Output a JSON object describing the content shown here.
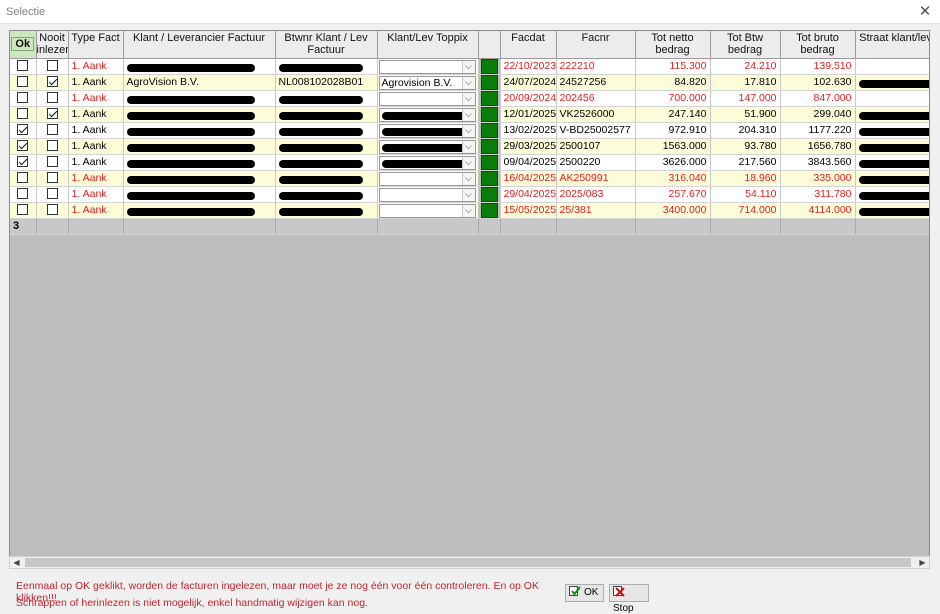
{
  "window": {
    "title": "Selectie",
    "close_glyph": "✕"
  },
  "columns": {
    "ok": "Ok",
    "nooit": "Nooit inlezen",
    "type": "Type Fact",
    "klant": "Klant / Leverancier Factuur",
    "btw": "Btwnr Klant / Lev Factuur",
    "toppix": "Klant/Lev Toppix",
    "status": "",
    "facdat": "Facdat",
    "facnr": "Facnr",
    "netto": "Tot netto bedrag",
    "btwbedrag": "Tot Btw bedrag",
    "bruto": "Tot bruto bedrag",
    "straat": "Straat klant/lev"
  },
  "rows": [
    {
      "ok": false,
      "nooit": false,
      "type": "1. Aank",
      "klant": "",
      "btw": "",
      "toppix": "",
      "facdat": "22/10/2023",
      "facnr": "222210",
      "netto": "115.300",
      "btwbedrag": "24.210",
      "bruto": "139.510",
      "red": true,
      "redact_klant": true,
      "redact_btw": true,
      "redact_toppix": false,
      "redact_straat": false
    },
    {
      "ok": false,
      "nooit": true,
      "type": "1. Aank",
      "klant": "AgroVision B.V.",
      "btw": "NL008102028B01",
      "toppix": "Agrovision B.V.",
      "facdat": "24/07/2024",
      "facnr": "24527256",
      "netto": "84.820",
      "btwbedrag": "17.810",
      "bruto": "102.630",
      "red": false,
      "redact_klant": false,
      "redact_btw": false,
      "redact_toppix": false,
      "redact_straat": true
    },
    {
      "ok": false,
      "nooit": false,
      "type": "1. Aank",
      "klant": "",
      "btw": "",
      "toppix": "",
      "facdat": "20/09/2024",
      "facnr": "202456",
      "netto": "700.000",
      "btwbedrag": "147.000",
      "bruto": "847.000",
      "red": true,
      "redact_klant": true,
      "redact_btw": true,
      "redact_toppix": false,
      "redact_straat": false
    },
    {
      "ok": false,
      "nooit": true,
      "type": "1. Aank",
      "klant": "",
      "btw": "",
      "toppix": "",
      "facdat": "12/01/2025",
      "facnr": "VK2526000",
      "netto": "247.140",
      "btwbedrag": "51.900",
      "bruto": "299.040",
      "red": false,
      "redact_klant": true,
      "redact_btw": true,
      "redact_toppix": true,
      "redact_straat": true
    },
    {
      "ok": true,
      "nooit": false,
      "type": "1. Aank",
      "klant": "",
      "btw": "",
      "toppix": "",
      "facdat": "13/02/2025",
      "facnr": "V-BD25002577",
      "netto": "972.910",
      "btwbedrag": "204.310",
      "bruto": "1177.220",
      "red": false,
      "redact_klant": true,
      "redact_btw": true,
      "redact_toppix": true,
      "redact_straat": true
    },
    {
      "ok": true,
      "nooit": false,
      "type": "1. Aank",
      "klant": "",
      "btw": "",
      "toppix": "",
      "facdat": "29/03/2025",
      "facnr": "2500107",
      "netto": "1563.000",
      "btwbedrag": "93.780",
      "bruto": "1656.780",
      "red": false,
      "redact_klant": true,
      "redact_btw": true,
      "redact_toppix": true,
      "redact_straat": true
    },
    {
      "ok": true,
      "nooit": false,
      "type": "1. Aank",
      "klant": "",
      "btw": "",
      "toppix": "",
      "facdat": "09/04/2025",
      "facnr": "2500220",
      "netto": "3626.000",
      "btwbedrag": "217.560",
      "bruto": "3843.560",
      "red": false,
      "redact_klant": true,
      "redact_btw": true,
      "redact_toppix": true,
      "redact_straat": true
    },
    {
      "ok": false,
      "nooit": false,
      "type": "1. Aank",
      "klant": "",
      "btw": "",
      "toppix": "",
      "facdat": "16/04/2025",
      "facnr": "AK250991",
      "netto": "316.040",
      "btwbedrag": "18.960",
      "bruto": "335.000",
      "red": true,
      "redact_klant": true,
      "redact_btw": true,
      "redact_toppix": false,
      "redact_straat": true
    },
    {
      "ok": false,
      "nooit": false,
      "type": "1. Aank",
      "klant": "",
      "btw": "",
      "toppix": "",
      "facdat": "29/04/2025",
      "facnr": "2025/083",
      "netto": "257.670",
      "btwbedrag": "54.110",
      "bruto": "311.780",
      "red": true,
      "redact_klant": true,
      "redact_btw": true,
      "redact_toppix": false,
      "redact_straat": true
    },
    {
      "ok": false,
      "nooit": false,
      "type": "1. Aank",
      "klant": "",
      "btw": "",
      "toppix": "",
      "facdat": "15/05/2025",
      "facnr": "25/381",
      "netto": "3400.000",
      "btwbedrag": "714.000",
      "bruto": "4114.000",
      "red": true,
      "redact_klant": true,
      "redact_btw": true,
      "redact_toppix": false,
      "redact_straat": true
    }
  ],
  "footer_row": {
    "count": "3"
  },
  "colors": {
    "ok_green": "#0a7d0a",
    "red_text": "#e61f1f",
    "row_yellow": "#fdfcd9",
    "grid_gray": "#bdbdbd"
  },
  "messages": {
    "line1": "Eenmaal op OK geklikt, worden de facturen ingelezen, maar moet je ze nog één voor één controleren. En op OK klikken!!!",
    "line2": "Schrappen of herinlezen is niet mogelijk, enkel handmatig wijzigen kan nog."
  },
  "buttons": {
    "ok": "OK",
    "stop": "Stop",
    "ok_icon": "check-icon",
    "stop_icon": "stop-icon"
  }
}
